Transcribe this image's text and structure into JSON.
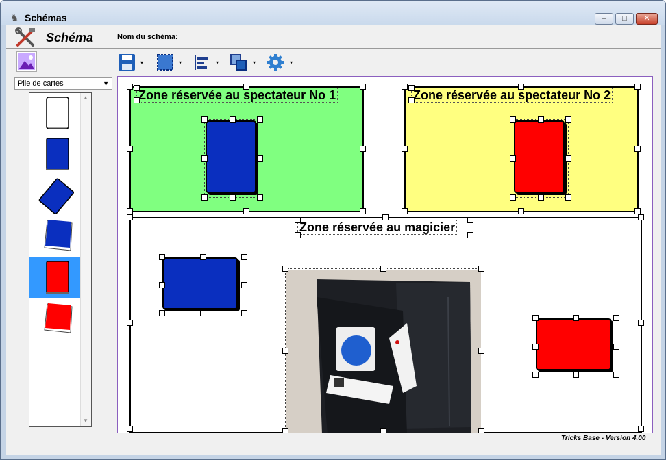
{
  "window": {
    "title": "Schémas",
    "minimize": "–",
    "maximize": "□",
    "close": "✕"
  },
  "header": {
    "app_title": "Schéma",
    "name_label": "Nom du schéma:"
  },
  "toolbar": {
    "buttons": [
      {
        "name": "save",
        "icon": "floppy-icon"
      },
      {
        "name": "select",
        "icon": "selection-icon"
      },
      {
        "name": "align",
        "icon": "align-icon"
      },
      {
        "name": "arrange",
        "icon": "layers-icon"
      },
      {
        "name": "settings",
        "icon": "gear-icon"
      }
    ],
    "dropdown_glyph": "▾"
  },
  "palette": {
    "category": "Pile de cartes",
    "items": [
      {
        "name": "white-card",
        "color": "#ffffff"
      },
      {
        "name": "blue-card",
        "color": "#0a2fbf"
      },
      {
        "name": "blue-card-rotated",
        "color": "#0a2fbf"
      },
      {
        "name": "blue-deck",
        "color": "#0a2fbf"
      },
      {
        "name": "red-card",
        "color": "#ff0000",
        "selected": true
      },
      {
        "name": "red-deck",
        "color": "#ff0000"
      }
    ]
  },
  "zones": [
    {
      "title": "Zone réservée au spectateur No 1",
      "color": "#80ff80"
    },
    {
      "title": "Zone réservée au spectateur No 2",
      "color": "#ffff80"
    },
    {
      "title": "Zone réservée au magicier",
      "color": "#ffffff"
    }
  ],
  "colors": {
    "blue": "#0a2fbf",
    "red": "#ff0000",
    "accent": "#3399ff",
    "canvas_border": "#8b5fbf"
  },
  "footer": {
    "version": "Tricks Base - Version 4.00"
  }
}
